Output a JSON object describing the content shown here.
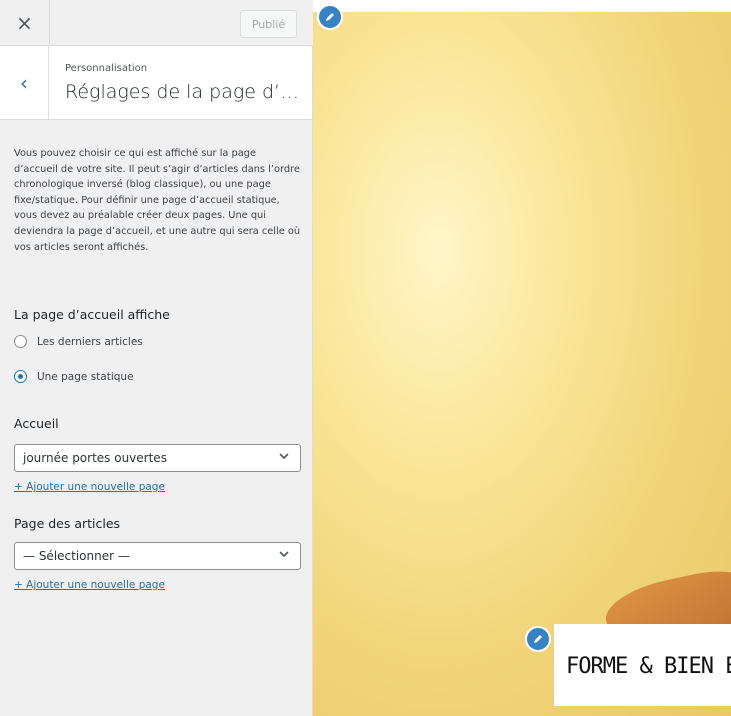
{
  "header": {
    "close_glyph": "×",
    "publish_label": "Publié"
  },
  "section": {
    "back_glyph": "‹",
    "breadcrumb": "Personnalisation",
    "title": "Réglages de la page d’acc..."
  },
  "description": "Vous pouvez choisir ce qui est affiché sur la page d’accueil de votre site. Il peut s’agir d’articles dans l’ordre chronologique inversé (blog classique), ou une page fixe/statique. Pour définir une page d’accueil statique, vous devez au préalable créer deux pages. Une qui deviendra la page d’accueil, et une autre qui sera celle où vos articles seront affichés.",
  "homepage_display": {
    "label": "La page d’accueil affiche",
    "options": [
      {
        "label": "Les derniers articles",
        "checked": false
      },
      {
        "label": "Une page statique",
        "checked": true
      }
    ]
  },
  "homepage_select": {
    "label": "Accueil",
    "value": "journée portes ouvertes",
    "add_link": "+ Ajouter une nouvelle page"
  },
  "posts_select": {
    "label": "Page des articles",
    "value": "— Sélectionner —",
    "add_link": "+ Ajouter une nouvelle page"
  },
  "preview": {
    "logo_text": "FORME & BIEN E",
    "accent_color": "#3582c4"
  }
}
